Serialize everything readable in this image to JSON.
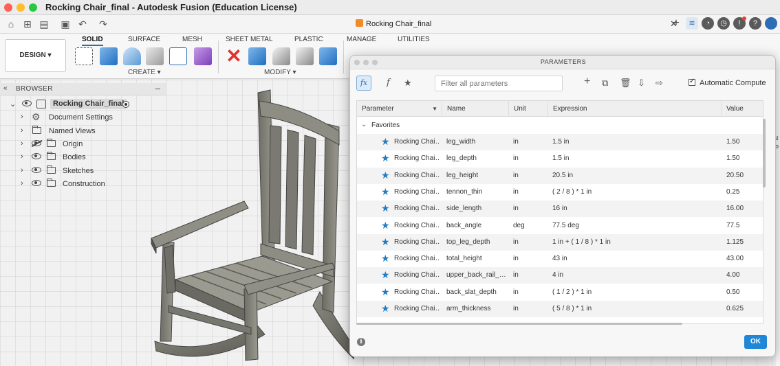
{
  "window": {
    "title": "Rocking Chair_final - Autodesk Fusion (Education License)"
  },
  "doc_tab": {
    "title": "Rocking Chair_final"
  },
  "ribbon": {
    "tabs": [
      "SOLID",
      "SURFACE",
      "MESH",
      "SHEET METAL",
      "PLASTIC",
      "MANAGE",
      "UTILITIES"
    ],
    "active_tab": "SOLID",
    "design_label": "DESIGN ▾",
    "groups": {
      "create": "CREATE ▾",
      "modify": "MODIFY ▾"
    }
  },
  "browser": {
    "header": "BROWSER",
    "root": "Rocking Chair_final",
    "items": [
      {
        "label": "Document Settings",
        "icon": "gear-icon"
      },
      {
        "label": "Named Views",
        "icon": "folder-icon"
      },
      {
        "label": "Origin",
        "icon": "folder-icon"
      },
      {
        "label": "Bodies",
        "icon": "folder-icon"
      },
      {
        "label": "Sketches",
        "icon": "folder-icon"
      },
      {
        "label": "Construction",
        "icon": "folder-icon"
      }
    ]
  },
  "dialog": {
    "title": "PARAMETERS",
    "filter_placeholder": "Filter all parameters",
    "auto_compute": "Automatic Compute",
    "ok": "OK",
    "columns": [
      "Parameter",
      "Name",
      "Unit",
      "Expression",
      "Value"
    ],
    "group": "Favorites",
    "rows": [
      {
        "param": "Rocking Chai…",
        "name": "leg_width",
        "unit": "in",
        "expr": "1.5 in",
        "value": "1.50"
      },
      {
        "param": "Rocking Chai…",
        "name": "leg_depth",
        "unit": "in",
        "expr": "1.5 in",
        "value": "1.50"
      },
      {
        "param": "Rocking Chai…",
        "name": "leg_height",
        "unit": "in",
        "expr": "20.5 in",
        "value": "20.50"
      },
      {
        "param": "Rocking Chai…",
        "name": "tennon_thin",
        "unit": "in",
        "expr": "( 2 / 8 ) * 1 in",
        "value": "0.25"
      },
      {
        "param": "Rocking Chai…",
        "name": "side_length",
        "unit": "in",
        "expr": "16 in",
        "value": "16.00"
      },
      {
        "param": "Rocking Chai…",
        "name": "back_angle",
        "unit": "deg",
        "expr": "77.5 deg",
        "value": "77.5"
      },
      {
        "param": "Rocking Chai…",
        "name": "top_leg_depth",
        "unit": "in",
        "expr": "1 in + ( 1 / 8 ) * 1 in",
        "value": "1.125"
      },
      {
        "param": "Rocking Chai…",
        "name": "total_height",
        "unit": "in",
        "expr": "43 in",
        "value": "43.00"
      },
      {
        "param": "Rocking Chai…",
        "name": "upper_back_rail_…",
        "unit": "in",
        "expr": "4 in",
        "value": "4.00"
      },
      {
        "param": "Rocking Chai…",
        "name": "back_slat_depth",
        "unit": "in",
        "expr": "( 1 / 2 ) * 1 in",
        "value": "0.50"
      },
      {
        "param": "Rocking Chai…",
        "name": "arm_thickness",
        "unit": "in",
        "expr": "( 5 / 8 ) * 1 in",
        "value": "0.625"
      }
    ]
  },
  "right_edge_text": [
    "at",
    "ro"
  ]
}
